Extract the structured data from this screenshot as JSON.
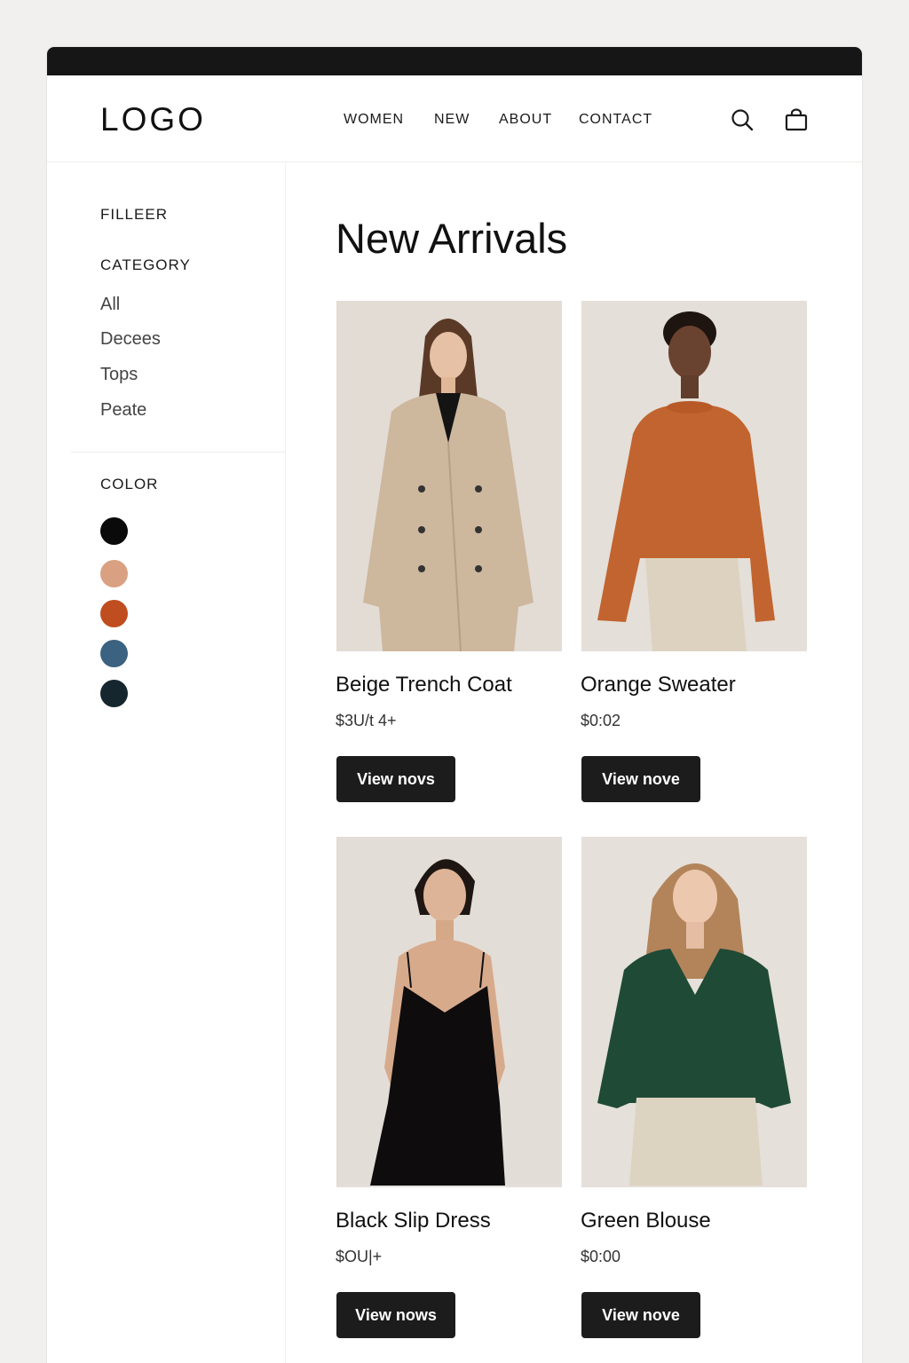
{
  "header": {
    "logo": "LOGO",
    "nav": [
      "WOMEN",
      "NEW",
      "ABOUT",
      "CONTACT"
    ],
    "icons": [
      "search-icon",
      "shopping-bag-icon"
    ]
  },
  "sidebar": {
    "filter_heading": "FILLEER",
    "category_heading": "CATEGORY",
    "categories": [
      "All",
      "Decees",
      "Tops",
      "Peate"
    ],
    "color_heading": "COLOR",
    "colors": [
      "#0a0a0a",
      "#d9a182",
      "#c04d1f",
      "#3b6280",
      "#16262e"
    ]
  },
  "main": {
    "title": "New Arrivals",
    "products": [
      {
        "name": "Beige Trench Coat",
        "price": "$3U/t 4+",
        "button": "View novs"
      },
      {
        "name": "Orange Sweater",
        "price": "$0:02",
        "button": "View nove"
      },
      {
        "name": "Black Slip Dress",
        "price": "$OU|+",
        "button": "View nows"
      },
      {
        "name": "Green Blouse",
        "price": "$0:00",
        "button": "View nove"
      }
    ]
  }
}
